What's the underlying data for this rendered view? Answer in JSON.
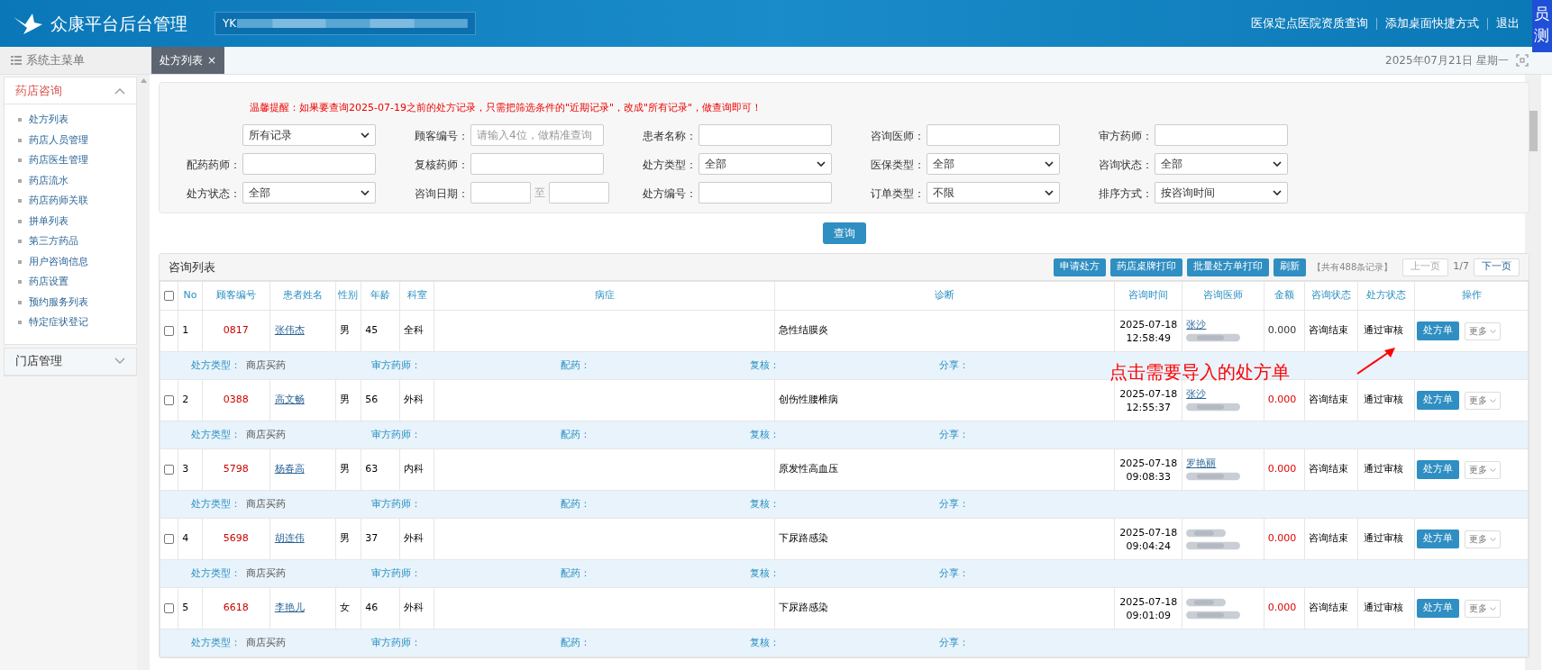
{
  "header": {
    "title": "众康平台后台管理",
    "account": "YK",
    "links": [
      "医保定点医院资质查询",
      "添加桌面快捷方式",
      "退出"
    ]
  },
  "overlay_window": {
    "lines": [
      "员",
      "测"
    ]
  },
  "tabbar": {
    "menu_label": "系统主菜单",
    "tabs": [
      {
        "label": "处方列表",
        "close": "×",
        "selected": true
      }
    ],
    "date": "2025年07月21日 星期一"
  },
  "sidebar": {
    "groups": [
      {
        "title": "药店咨询",
        "expanded": true,
        "items": [
          "处方列表",
          "药店人员管理",
          "药店医生管理",
          "药店流水",
          "药店药师关联",
          "拼单列表",
          "第三方药品",
          "用户咨询信息",
          "药店设置",
          "预约服务列表",
          "特定症状登记"
        ]
      },
      {
        "title": "门店管理",
        "expanded": false
      }
    ]
  },
  "filters": {
    "warning": "温馨提醒：如果要查询2025-07-19之前的处方记录，只需把筛选条件的\"近期记录\"，改成\"所有记录\"，做查询即可！",
    "fields": [
      {
        "kind": "select",
        "value": "所有记录"
      },
      {
        "kind": "input",
        "label": "顾客编号：",
        "placeholder": "请输入4位，做精准查询"
      },
      {
        "kind": "input",
        "label": "患者名称："
      },
      {
        "kind": "input",
        "label": "咨询医师："
      },
      {
        "kind": "input",
        "label": "审方药师："
      },
      {
        "kind": "input",
        "label": "配药药师："
      },
      {
        "kind": "input",
        "label": "复核药师："
      },
      {
        "kind": "select",
        "label": "处方类型：",
        "value": "全部"
      },
      {
        "kind": "select",
        "label": "医保类型：",
        "value": "全部"
      },
      {
        "kind": "select",
        "label": "咨询状态：",
        "value": "全部"
      },
      {
        "kind": "select",
        "label": "处方状态：",
        "value": "全部"
      },
      {
        "kind": "range",
        "label": "咨询日期：",
        "separator": "至"
      },
      {
        "kind": "input",
        "label": "处方编号："
      },
      {
        "kind": "select",
        "label": "订单类型：",
        "value": "不限"
      },
      {
        "kind": "select",
        "label": "排序方式：",
        "value": "按咨询时间"
      }
    ],
    "search_button": "查询"
  },
  "table": {
    "title": "咨询列表",
    "select_all_checked": false,
    "actions": [
      "申请处方",
      "药店桌牌打印",
      "批量处方单打印",
      "刷新"
    ],
    "total": "【共有488条记录】",
    "prev": "上一页",
    "page": "1/7",
    "next": "下一页",
    "columns": [
      "No",
      "顾客编号",
      "患者姓名",
      "性别",
      "年龄",
      "科室",
      "病症",
      "诊断",
      "咨询时间",
      "咨询医师",
      "金额",
      "咨询状态",
      "处方状态",
      "操作"
    ],
    "rows": [
      {
        "checked": false,
        "no": "1",
        "code": "0817",
        "name": "张伟杰",
        "sex": "男",
        "age": "45",
        "dept": "全科",
        "diagnosis": "急性结膜炎",
        "date": "2025-07-18",
        "time": "12:58:49",
        "doctor": "张沙",
        "amount": "0.000",
        "amount_alert": false,
        "consult_status": "咨询结束",
        "rx_status": "通过审核",
        "rx_button": "处方单",
        "more": "更多",
        "rx_type": "商店买药",
        "details": [
          "处方类型：",
          "审方药师：",
          "配药：",
          "复核：",
          "分享："
        ]
      },
      {
        "checked": false,
        "no": "2",
        "code": "0388",
        "name": "高文畅",
        "sex": "男",
        "age": "56",
        "dept": "外科",
        "diagnosis": "创伤性腰椎病",
        "date": "2025-07-18",
        "time": "12:55:37",
        "doctor": "张沙",
        "amount": "0.000",
        "amount_alert": true,
        "consult_status": "咨询结束",
        "rx_status": "通过审核",
        "rx_button": "处方单",
        "more": "更多",
        "rx_type": "商店买药",
        "details": [
          "处方类型：",
          "审方药师：",
          "配药：",
          "复核：",
          "分享："
        ]
      },
      {
        "checked": false,
        "no": "3",
        "code": "5798",
        "name": "杨春高",
        "sex": "男",
        "age": "63",
        "dept": "内科",
        "diagnosis": "原发性高血压",
        "date": "2025-07-18",
        "time": "09:08:33",
        "doctor": "罗艳丽",
        "amount": "0.000",
        "amount_alert": true,
        "consult_status": "咨询结束",
        "rx_status": "通过审核",
        "rx_button": "处方单",
        "more": "更多",
        "rx_type": "商店买药",
        "details": [
          "处方类型：",
          "审方药师：",
          "配药：",
          "复核：",
          "分享："
        ]
      },
      {
        "checked": false,
        "no": "4",
        "code": "5698",
        "name": "胡连伟",
        "sex": "男",
        "age": "37",
        "dept": "外科",
        "diagnosis": "下尿路感染",
        "date": "2025-07-18",
        "time": "09:04:24",
        "amount": "0.000",
        "amount_alert": true,
        "consult_status": "咨询结束",
        "rx_status": "通过审核",
        "rx_button": "处方单",
        "more": "更多",
        "rx_type": "商店买药",
        "details": [
          "处方类型：",
          "审方药师：",
          "配药：",
          "复核：",
          "分享："
        ]
      },
      {
        "checked": false,
        "no": "5",
        "code": "6618",
        "name": "李艳儿",
        "sex": "女",
        "age": "46",
        "dept": "外科",
        "diagnosis": "下尿路感染",
        "date": "2025-07-18",
        "time": "09:01:09",
        "amount": "0.000",
        "amount_alert": true,
        "consult_status": "咨询结束",
        "rx_status": "通过审核",
        "rx_button": "处方单",
        "more": "更多",
        "rx_type": "商店买药",
        "details": [
          "处方类型：",
          "审方药师：",
          "配药：",
          "复核：",
          "分享："
        ]
      }
    ]
  },
  "annotation": {
    "text": "点击需要导入的处方单"
  }
}
